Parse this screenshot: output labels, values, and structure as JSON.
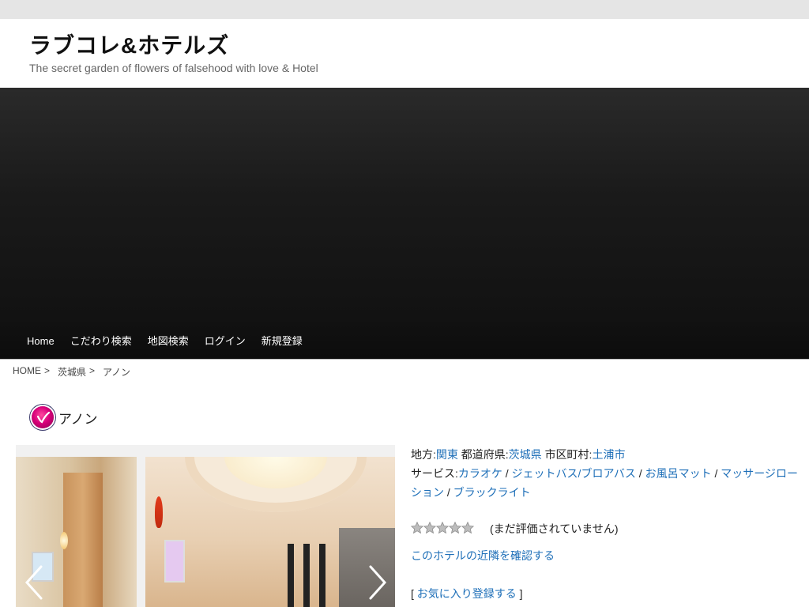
{
  "header": {
    "title": "ラブコレ&ホテルズ",
    "tagline": "The secret garden of flowers of falsehood with love & Hotel"
  },
  "nav": {
    "items": [
      "Home",
      "こだわり検索",
      "地図検索",
      "ログイン",
      "新規登録"
    ]
  },
  "breadcrumb": {
    "items": [
      "HOME",
      "茨城県",
      "アノン"
    ],
    "separator": ">"
  },
  "hotel": {
    "name": "アノン",
    "region_label": "地方:",
    "region": "関東",
    "prefecture_label": "都道府県:",
    "prefecture": "茨城県",
    "city_label": "市区町村:",
    "city": "土浦市",
    "services_label": "サービス:",
    "services": [
      "カラオケ",
      "ジェットバス/ブロアバス",
      "お風呂マット",
      "マッサージローション",
      "ブラックライト"
    ],
    "service_separator": " / ",
    "rating": {
      "stars_total": 5,
      "stars_filled": 0,
      "text": "(まだ評価されていません)"
    },
    "nearby_link": "このホテルの近隣を確認する",
    "favorite": {
      "prefix": "[ ",
      "label": "お気に入り登録する",
      "suffix": " ]"
    }
  },
  "colors": {
    "link": "#1e6fb8",
    "hero_bg": "#161616",
    "topbar": "#e5e5e5"
  },
  "icons": [
    "heart-logo-icon",
    "star-icon",
    "chevron-left-icon",
    "chevron-right-icon"
  ]
}
